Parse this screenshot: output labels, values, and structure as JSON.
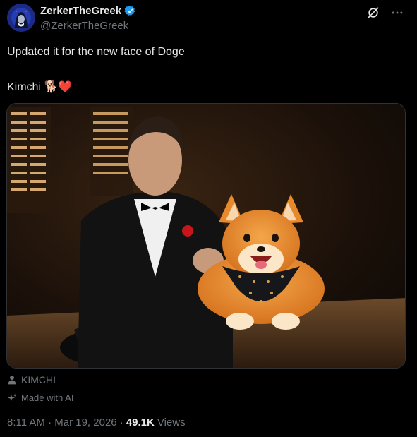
{
  "author": {
    "display_name": "ZerkerTheGreek",
    "handle": "@ZerkerTheGreek",
    "verified": true,
    "avatar_icon": "avatar-hooded-figure"
  },
  "post": {
    "text_line_1": "Updated it for the new face of Doge",
    "text_line_2": "Kimchi 🐕❤️"
  },
  "media": {
    "alt": "Man in tuxedo with a red rose seated at a desk, petting a cartoon Shiba Inu dog wearing a black bandana",
    "bandana_color": "#15171a",
    "dog_color": "#e8892c"
  },
  "meta": {
    "community_note_label": "KIMCHI",
    "made_with_ai_label": "Made with AI"
  },
  "footer": {
    "timestamp": "8:11 AM · Mar 19, 2026 ·",
    "views_count": "49.1K",
    "views_label": "Views"
  },
  "colors": {
    "background": "#000000",
    "text": "#e7e9ea",
    "secondary": "#71767b",
    "verified": "#1d9bf0",
    "border": "#2f3336"
  }
}
